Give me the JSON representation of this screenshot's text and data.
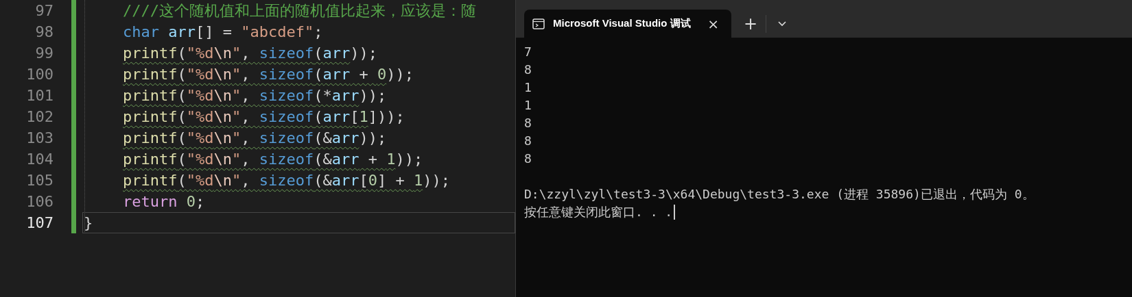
{
  "editor": {
    "lines": [
      {
        "number": "97",
        "selected": false,
        "squiggle": false,
        "tokens": [
          {
            "kind": "comment",
            "text": "////这个随机值和上面的随机值比起来，应该是：随"
          }
        ]
      },
      {
        "number": "98",
        "selected": false,
        "squiggle": false,
        "tokens": [
          {
            "kind": "keyword",
            "text": "char"
          },
          {
            "kind": "variable",
            "text": " arr"
          },
          {
            "kind": "plain",
            "text": "[] = "
          },
          {
            "kind": "string",
            "text": "\"abcdef\""
          },
          {
            "kind": "plain",
            "text": ";"
          }
        ]
      },
      {
        "number": "99",
        "selected": false,
        "squiggle": true,
        "tokens": [
          {
            "kind": "function",
            "text": "printf"
          },
          {
            "kind": "plain",
            "text": "("
          },
          {
            "kind": "string",
            "text": "\"%d"
          },
          {
            "kind": "escape",
            "text": "\\n"
          },
          {
            "kind": "string",
            "text": "\""
          },
          {
            "kind": "plain",
            "text": ", "
          },
          {
            "kind": "keyword",
            "text": "sizeof"
          },
          {
            "kind": "plain",
            "text": "("
          },
          {
            "kind": "variable",
            "text": "arr"
          },
          {
            "kind": "plain",
            "text": "));"
          }
        ]
      },
      {
        "number": "100",
        "selected": false,
        "squiggle": true,
        "tokens": [
          {
            "kind": "function",
            "text": "printf"
          },
          {
            "kind": "plain",
            "text": "("
          },
          {
            "kind": "string",
            "text": "\"%d"
          },
          {
            "kind": "escape",
            "text": "\\n"
          },
          {
            "kind": "string",
            "text": "\""
          },
          {
            "kind": "plain",
            "text": ", "
          },
          {
            "kind": "keyword",
            "text": "sizeof"
          },
          {
            "kind": "plain",
            "text": "("
          },
          {
            "kind": "variable",
            "text": "arr"
          },
          {
            "kind": "plain",
            "text": " + "
          },
          {
            "kind": "number",
            "text": "0"
          },
          {
            "kind": "plain",
            "text": "));"
          }
        ]
      },
      {
        "number": "101",
        "selected": false,
        "squiggle": true,
        "tokens": [
          {
            "kind": "function",
            "text": "printf"
          },
          {
            "kind": "plain",
            "text": "("
          },
          {
            "kind": "string",
            "text": "\"%d"
          },
          {
            "kind": "escape",
            "text": "\\n"
          },
          {
            "kind": "string",
            "text": "\""
          },
          {
            "kind": "plain",
            "text": ", "
          },
          {
            "kind": "keyword",
            "text": "sizeof"
          },
          {
            "kind": "plain",
            "text": "(*"
          },
          {
            "kind": "variable",
            "text": "arr"
          },
          {
            "kind": "plain",
            "text": "));"
          }
        ]
      },
      {
        "number": "102",
        "selected": false,
        "squiggle": true,
        "tokens": [
          {
            "kind": "function",
            "text": "printf"
          },
          {
            "kind": "plain",
            "text": "("
          },
          {
            "kind": "string",
            "text": "\"%d"
          },
          {
            "kind": "escape",
            "text": "\\n"
          },
          {
            "kind": "string",
            "text": "\""
          },
          {
            "kind": "plain",
            "text": ", "
          },
          {
            "kind": "keyword",
            "text": "sizeof"
          },
          {
            "kind": "plain",
            "text": "("
          },
          {
            "kind": "variable",
            "text": "arr"
          },
          {
            "kind": "plain",
            "text": "["
          },
          {
            "kind": "number",
            "text": "1"
          },
          {
            "kind": "plain",
            "text": "]));"
          }
        ]
      },
      {
        "number": "103",
        "selected": false,
        "squiggle": true,
        "tokens": [
          {
            "kind": "function",
            "text": "printf"
          },
          {
            "kind": "plain",
            "text": "("
          },
          {
            "kind": "string",
            "text": "\"%d"
          },
          {
            "kind": "escape",
            "text": "\\n"
          },
          {
            "kind": "string",
            "text": "\""
          },
          {
            "kind": "plain",
            "text": ", "
          },
          {
            "kind": "keyword",
            "text": "sizeof"
          },
          {
            "kind": "plain",
            "text": "(&"
          },
          {
            "kind": "variable",
            "text": "arr"
          },
          {
            "kind": "plain",
            "text": "));"
          }
        ]
      },
      {
        "number": "104",
        "selected": false,
        "squiggle": true,
        "tokens": [
          {
            "kind": "function",
            "text": "printf"
          },
          {
            "kind": "plain",
            "text": "("
          },
          {
            "kind": "string",
            "text": "\"%d"
          },
          {
            "kind": "escape",
            "text": "\\n"
          },
          {
            "kind": "string",
            "text": "\""
          },
          {
            "kind": "plain",
            "text": ", "
          },
          {
            "kind": "keyword",
            "text": "sizeof"
          },
          {
            "kind": "plain",
            "text": "(&"
          },
          {
            "kind": "variable",
            "text": "arr"
          },
          {
            "kind": "plain",
            "text": " + "
          },
          {
            "kind": "number",
            "text": "1"
          },
          {
            "kind": "plain",
            "text": "));"
          }
        ]
      },
      {
        "number": "105",
        "selected": false,
        "squiggle": true,
        "tokens": [
          {
            "kind": "function",
            "text": "printf"
          },
          {
            "kind": "plain",
            "text": "("
          },
          {
            "kind": "string",
            "text": "\"%d"
          },
          {
            "kind": "escape",
            "text": "\\n"
          },
          {
            "kind": "string",
            "text": "\""
          },
          {
            "kind": "plain",
            "text": ", "
          },
          {
            "kind": "keyword",
            "text": "sizeof"
          },
          {
            "kind": "plain",
            "text": "(&"
          },
          {
            "kind": "variable",
            "text": "arr"
          },
          {
            "kind": "plain",
            "text": "["
          },
          {
            "kind": "number",
            "text": "0"
          },
          {
            "kind": "plain",
            "text": "] + "
          },
          {
            "kind": "number",
            "text": "1"
          },
          {
            "kind": "plain",
            "text": "));"
          }
        ]
      },
      {
        "number": "106",
        "selected": false,
        "squiggle": false,
        "tokens": [
          {
            "kind": "control",
            "text": "return"
          },
          {
            "kind": "number",
            "text": " 0"
          },
          {
            "kind": "plain",
            "text": ";"
          }
        ]
      },
      {
        "number": "107",
        "selected": true,
        "squiggle": false,
        "tokens": [
          {
            "kind": "plain",
            "text": "}"
          }
        ]
      }
    ]
  },
  "terminal": {
    "tab": {
      "title": "Microsoft Visual Studio 调试",
      "close": "×"
    },
    "new_tab": "+",
    "output": [
      "7",
      "8",
      "1",
      "1",
      "8",
      "8",
      "8"
    ],
    "exit_message": [
      "D:\\zzyl\\zyl\\test3-3\\x64\\Debug\\test3-3.exe (进程 35896)已退出，代码为 0。",
      "按任意键关闭此窗口. . ."
    ]
  }
}
